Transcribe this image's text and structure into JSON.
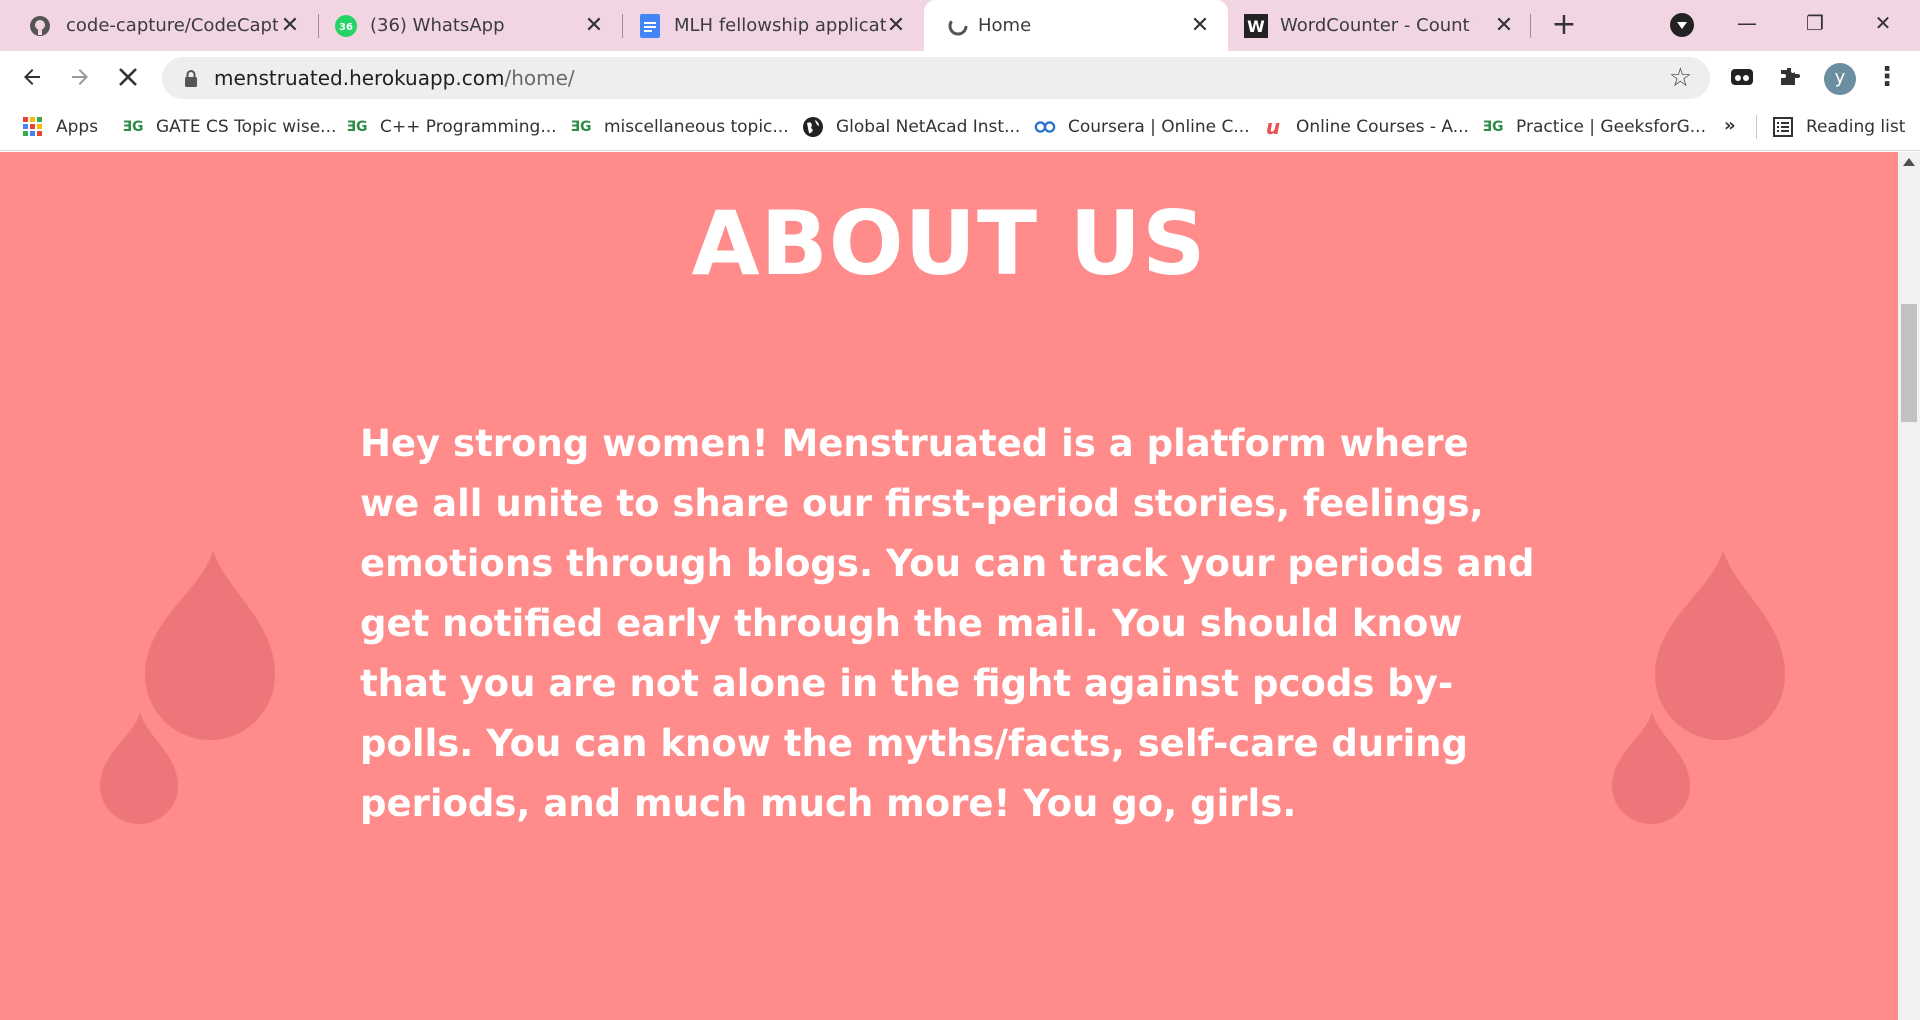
{
  "browser": {
    "tabs": [
      {
        "title": "code-capture/CodeCaptur",
        "icon": "github-icon"
      },
      {
        "title": "(36) WhatsApp",
        "icon": "whatsapp-icon",
        "badge": "36"
      },
      {
        "title": "MLH fellowship applicatio",
        "icon": "google-docs-icon"
      },
      {
        "title": "Home",
        "icon": "loading-icon",
        "active": true
      },
      {
        "title": "WordCounter - Count Wo",
        "icon": "wordcounter-icon",
        "badge": "W"
      }
    ],
    "close_glyph": "✕",
    "new_tab_glyph": "+",
    "window_controls": {
      "minimize": "—",
      "restore": "❐",
      "close": "✕"
    },
    "url_host": "menstruated.herokuapp.com",
    "url_path": "/home/",
    "avatar_letter": "y",
    "bookmarks": [
      {
        "label": "Apps",
        "icon": "apps-grid-icon"
      },
      {
        "label": "GATE CS Topic wise...",
        "icon": "geeksforgeeks-icon"
      },
      {
        "label": "C++ Programming...",
        "icon": "geeksforgeeks-icon"
      },
      {
        "label": "miscellaneous topic...",
        "icon": "geeksforgeeks-icon"
      },
      {
        "label": "Global NetAcad Inst...",
        "icon": "globe-icon"
      },
      {
        "label": "Coursera | Online C...",
        "icon": "coursera-icon"
      },
      {
        "label": "Online Courses - A...",
        "icon": "udemy-icon"
      },
      {
        "label": "Practice | GeeksforG...",
        "icon": "geeksforgeeks-icon"
      }
    ],
    "bookmarks_more": "»",
    "reading_list": "Reading list",
    "gfg_glyph": "ƎG",
    "udemy_glyph": "u"
  },
  "page": {
    "title": "ABOUT US",
    "body": "Hey strong women! Menstruated is a platform where we all unite to share our first-period stories, feelings, emotions through blogs. You can track your periods and get notified early through the mail. You should know that you are not alone in the fight against pcods by-polls. You can know the myths/facts, self-care during periods, and much much more! You go, girls.",
    "background_color": "#ff8b8b",
    "drop_color": "#e97276"
  }
}
